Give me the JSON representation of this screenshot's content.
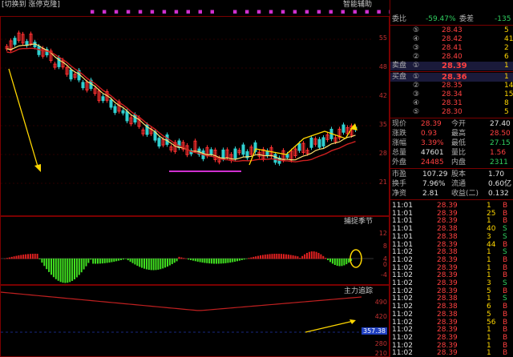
{
  "chart": {
    "top_label": "[切换到 涨停克隆]",
    "top_right_label": "智能辅助",
    "main_y_ticks": [
      "55",
      "48",
      "42",
      "35",
      "28",
      "21"
    ],
    "osc_title": "捕捉季节",
    "osc_y_ticks": [
      "12",
      "8",
      "4",
      "0",
      "-4"
    ],
    "flow_title": "主力追踪",
    "flow_y_ticks": [
      "490",
      "420",
      "357.38",
      "280",
      "210"
    ],
    "flow_current_value": "357.38"
  },
  "quote": {
    "weibi": {
      "label": "委比",
      "value": "-59.47%",
      "label2": "委差",
      "value2": "-135"
    },
    "sell": [
      {
        "level": "⑤",
        "price": "28.43",
        "vol": "5"
      },
      {
        "level": "④",
        "price": "28.42",
        "vol": "41"
      },
      {
        "level": "③",
        "price": "28.41",
        "vol": "2"
      },
      {
        "level": "②",
        "price": "28.40",
        "vol": "6"
      },
      {
        "level": "①",
        "price": "28.39",
        "vol": "1",
        "tag": "卖盘"
      }
    ],
    "buy": [
      {
        "level": "①",
        "price": "28.36",
        "vol": "1",
        "tag": "买盘"
      },
      {
        "level": "②",
        "price": "28.35",
        "vol": "14"
      },
      {
        "level": "③",
        "price": "28.34",
        "vol": "15"
      },
      {
        "level": "④",
        "price": "28.31",
        "vol": "8"
      },
      {
        "level": "⑤",
        "price": "28.30",
        "vol": "5"
      }
    ],
    "stats": [
      {
        "l1": "现价",
        "v1": "28.39",
        "c1": "red",
        "l2": "今开",
        "v2": "27.40",
        "c2": "white"
      },
      {
        "l1": "涨跌",
        "v1": "0.93",
        "c1": "red",
        "l2": "最高",
        "v2": "28.50",
        "c2": "red"
      },
      {
        "l1": "涨幅",
        "v1": "3.39%",
        "c1": "red",
        "l2": "最低",
        "v2": "27.15",
        "c2": "green"
      },
      {
        "l1": "总量",
        "v1": "47601",
        "c1": "white",
        "l2": "量比",
        "v2": "1.56",
        "c2": "red"
      },
      {
        "l1": "外盘",
        "v1": "24485",
        "c1": "red",
        "l2": "内盘",
        "v2": "2311",
        "c2": "green"
      }
    ],
    "stats2": [
      {
        "l1": "市盈",
        "v1": "107.29",
        "l2": "股本",
        "v2": "1.70"
      },
      {
        "l1": "换手",
        "v1": "7.96%",
        "l2": "流通",
        "v2": "0.60亿"
      },
      {
        "l1": "净资",
        "v1": "2.81",
        "l2": "收益(二)",
        "v2": "0.132"
      }
    ],
    "ticks": [
      {
        "time": "11:01",
        "price": "28.39",
        "vol": "1",
        "side": "B"
      },
      {
        "time": "11:01",
        "price": "28.39",
        "vol": "25",
        "side": "B"
      },
      {
        "time": "11:01",
        "price": "28.39",
        "vol": "1",
        "side": "B"
      },
      {
        "time": "11:01",
        "price": "28.38",
        "vol": "40",
        "side": "S"
      },
      {
        "time": "11:01",
        "price": "28.38",
        "vol": "3",
        "side": "S"
      },
      {
        "time": "11:01",
        "price": "28.39",
        "vol": "44",
        "side": "B"
      },
      {
        "time": "11:02",
        "price": "28.38",
        "vol": "1",
        "side": "S"
      },
      {
        "time": "11:02",
        "price": "28.39",
        "vol": "1",
        "side": "B"
      },
      {
        "time": "11:02",
        "price": "28.39",
        "vol": "1",
        "side": "B"
      },
      {
        "time": "11:02",
        "price": "28.39",
        "vol": "1",
        "side": "B"
      },
      {
        "time": "11:02",
        "price": "28.39",
        "vol": "3",
        "side": "S"
      },
      {
        "time": "11:02",
        "price": "28.39",
        "vol": "5",
        "side": "B"
      },
      {
        "time": "11:02",
        "price": "28.38",
        "vol": "1",
        "side": "S"
      },
      {
        "time": "11:02",
        "price": "28.38",
        "vol": "6",
        "side": "B"
      },
      {
        "time": "11:02",
        "price": "28.38",
        "vol": "5",
        "side": "B"
      },
      {
        "time": "11:02",
        "price": "28.39",
        "vol": "56",
        "side": "B"
      },
      {
        "time": "11:02",
        "price": "28.39",
        "vol": "1",
        "side": "B"
      },
      {
        "time": "11:02",
        "price": "28.39",
        "vol": "1",
        "side": "B"
      },
      {
        "time": "11:02",
        "price": "28.39",
        "vol": "1",
        "side": "B"
      },
      {
        "time": "11:02",
        "price": "28.39",
        "vol": "1",
        "side": "B"
      }
    ]
  },
  "colors": {
    "up": "#ff3030",
    "down": "#30d0d0",
    "ma1": "#ffe070",
    "ma2": "#d02020",
    "accent": "#ffd700",
    "purple": "#d030d0",
    "osc_pos": "#e02020",
    "osc_neg": "#40e020"
  }
}
